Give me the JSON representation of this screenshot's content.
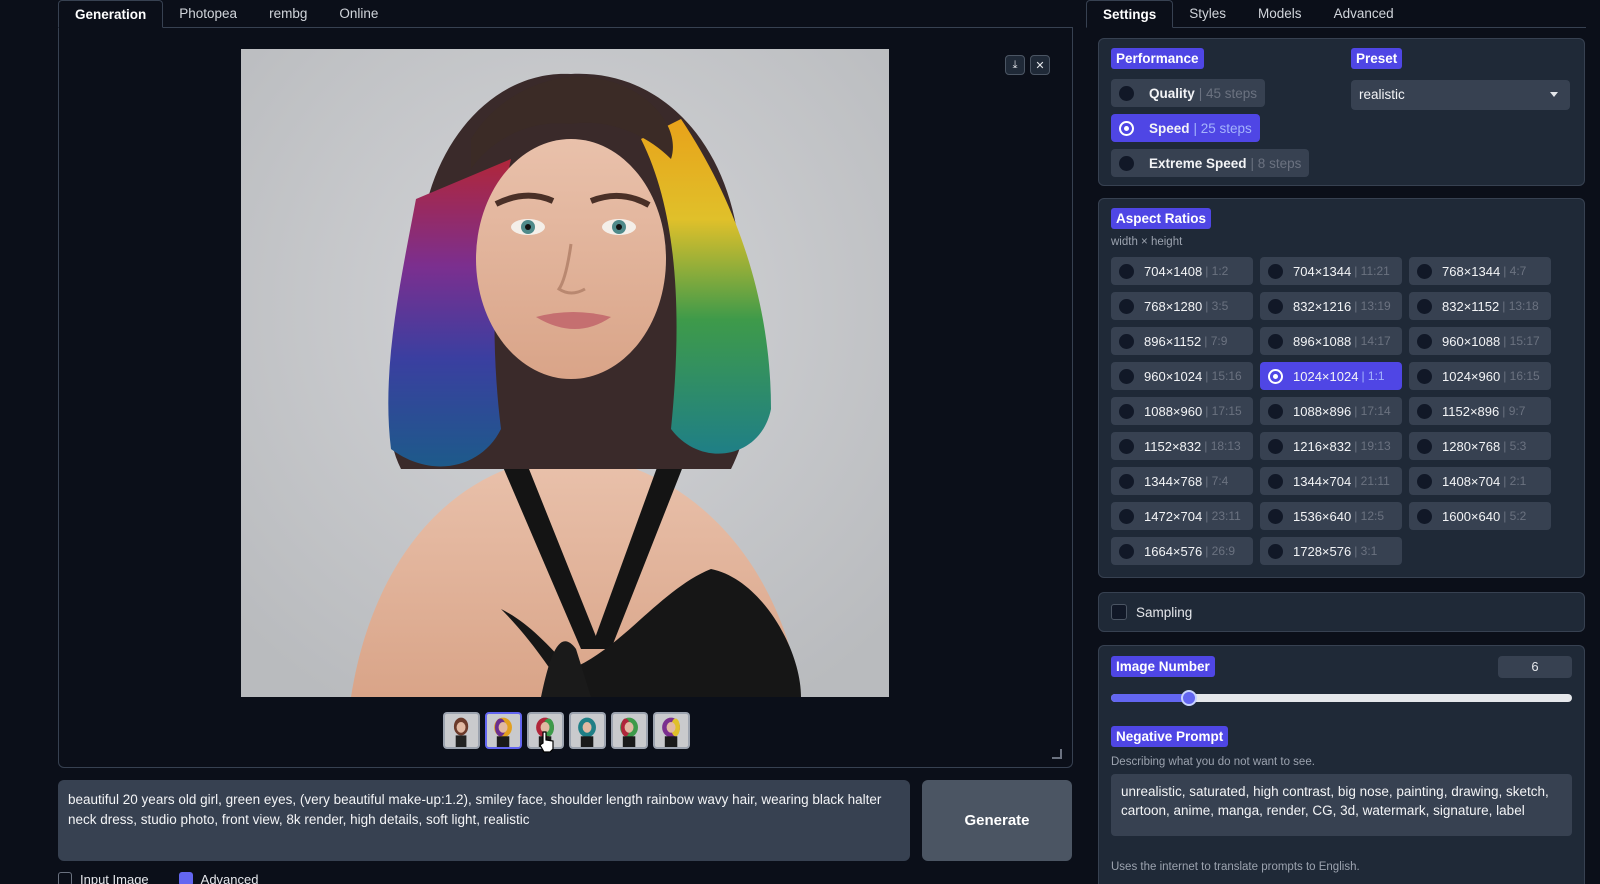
{
  "left_tabs": [
    "Generation",
    "Photopea",
    "rembg",
    "Online"
  ],
  "right_tabs": [
    "Settings",
    "Styles",
    "Models",
    "Advanced"
  ],
  "prompt": "beautiful 20 years old girl, green eyes, (very beautiful make-up:1.2), smiley face, shoulder length rainbow wavy hair, wearing black halter neck dress, studio photo, front view, 8k render, high details, soft light, realistic",
  "generate_label": "Generate",
  "under_prompt": {
    "input_image": "Input Image",
    "advanced": "Advanced"
  },
  "thumbnails": {
    "count": 6,
    "selected_index": 1
  },
  "performance": {
    "label": "Performance",
    "options": [
      {
        "name": "Quality",
        "steps": "| 45 steps",
        "selected": false
      },
      {
        "name": "Speed",
        "steps": "| 25 steps",
        "selected": true
      },
      {
        "name": "Extreme Speed",
        "steps": "| 8 steps",
        "selected": false
      }
    ]
  },
  "preset": {
    "label": "Preset",
    "value": "realistic"
  },
  "aspect_ratios": {
    "label": "Aspect Ratios",
    "hint": "width × height",
    "items": [
      {
        "size": "704×1408",
        "ratio": "| 1:2"
      },
      {
        "size": "704×1344",
        "ratio": "| 11:21"
      },
      {
        "size": "768×1344",
        "ratio": "| 4:7"
      },
      {
        "size": "768×1280",
        "ratio": "| 3:5"
      },
      {
        "size": "832×1216",
        "ratio": "| 13:19"
      },
      {
        "size": "832×1152",
        "ratio": "| 13:18"
      },
      {
        "size": "896×1152",
        "ratio": "| 7:9"
      },
      {
        "size": "896×1088",
        "ratio": "| 14:17"
      },
      {
        "size": "960×1088",
        "ratio": "| 15:17"
      },
      {
        "size": "960×1024",
        "ratio": "| 15:16"
      },
      {
        "size": "1024×1024",
        "ratio": "| 1:1",
        "selected": true
      },
      {
        "size": "1024×960",
        "ratio": "| 16:15"
      },
      {
        "size": "1088×960",
        "ratio": "| 17:15"
      },
      {
        "size": "1088×896",
        "ratio": "| 17:14"
      },
      {
        "size": "1152×896",
        "ratio": "| 9:7"
      },
      {
        "size": "1152×832",
        "ratio": "| 18:13"
      },
      {
        "size": "1216×832",
        "ratio": "| 19:13"
      },
      {
        "size": "1280×768",
        "ratio": "| 5:3"
      },
      {
        "size": "1344×768",
        "ratio": "| 7:4"
      },
      {
        "size": "1344×704",
        "ratio": "| 21:11"
      },
      {
        "size": "1408×704",
        "ratio": "| 2:1"
      },
      {
        "size": "1472×704",
        "ratio": "| 23:11"
      },
      {
        "size": "1536×640",
        "ratio": "| 12:5"
      },
      {
        "size": "1600×640",
        "ratio": "| 5:2"
      },
      {
        "size": "1664×576",
        "ratio": "| 26:9"
      },
      {
        "size": "1728×576",
        "ratio": "| 3:1"
      }
    ]
  },
  "sampling": {
    "label": "Sampling",
    "checked": false
  },
  "image_number": {
    "label": "Image Number",
    "value": "6",
    "fraction": 0.17
  },
  "negative_prompt": {
    "label": "Negative Prompt",
    "hint": "Describing what you do not want to see.",
    "value": "unrealistic, saturated, high contrast, big nose, painting, drawing, sketch, cartoon, anime, manga, render, CG, 3d, watermark, signature, label"
  },
  "translate_hint": "Uses the internet to translate prompts to English.",
  "colors": {
    "accent": "#4f46e5",
    "background": "#0b0f19",
    "panel": "#1f2937",
    "control": "#374151"
  }
}
